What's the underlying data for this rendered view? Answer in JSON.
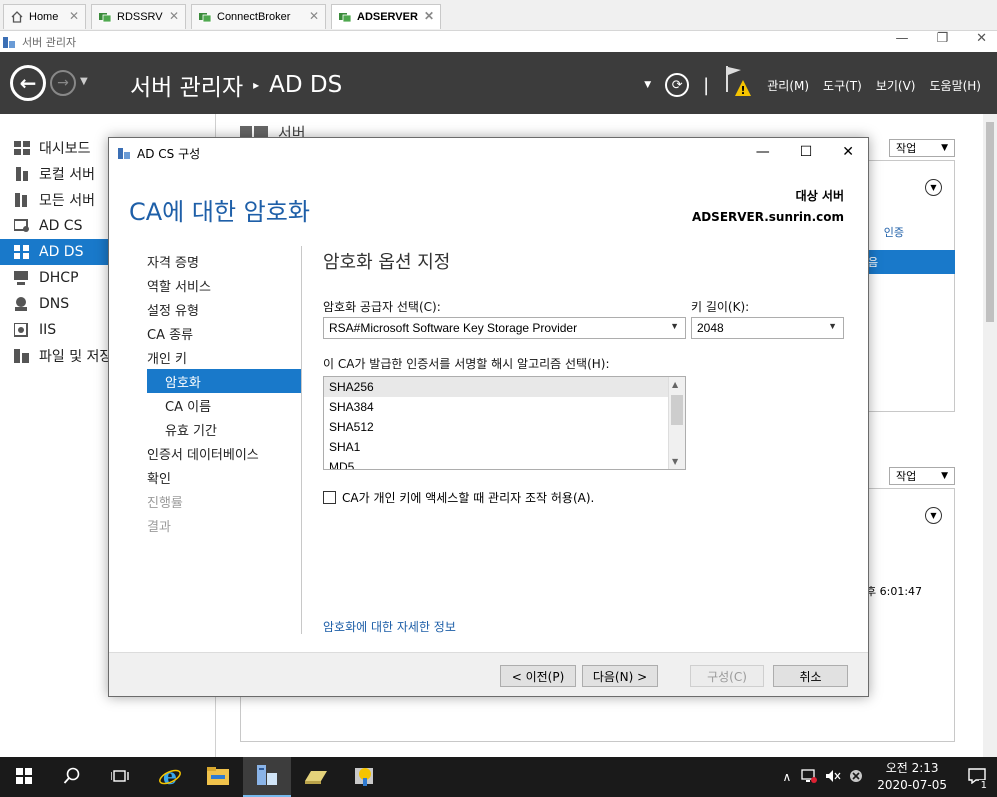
{
  "host_tabs": [
    {
      "label": "Home"
    },
    {
      "label": "RDSSRV"
    },
    {
      "label": "ConnectBroker"
    },
    {
      "label": "ADSERVER"
    }
  ],
  "window": {
    "title": "서버 관리자"
  },
  "header": {
    "breadcrumb_root": "서버 관리자",
    "breadcrumb_current": "AD DS",
    "menu_manage": "관리(M)",
    "menu_tools": "도구(T)",
    "menu_view": "보기(V)",
    "menu_help": "도움말(H)"
  },
  "sidebar": {
    "items": [
      {
        "label": "대시보드"
      },
      {
        "label": "로컬 서버"
      },
      {
        "label": "모든 서버"
      },
      {
        "label": "AD CS"
      },
      {
        "label": "AD DS"
      },
      {
        "label": "DHCP"
      },
      {
        "label": "DNS"
      },
      {
        "label": "IIS"
      },
      {
        "label": "파일 및 저장"
      }
    ]
  },
  "background": {
    "section_title": "서버",
    "tasks_label": "작업",
    "partial_col": "인증",
    "partial_row": "음",
    "partial_time": "후 6:01:47"
  },
  "dialog": {
    "title": "AD CS 구성",
    "heading": "CA에 대한 암호화",
    "target_label": "대상 서버",
    "target_value": "ADSERVER.sunrin.com",
    "steps": [
      {
        "label": "자격 증명"
      },
      {
        "label": "역할 서비스"
      },
      {
        "label": "설정 유형"
      },
      {
        "label": "CA 종류"
      },
      {
        "label": "개인 키"
      },
      {
        "label": "암호화"
      },
      {
        "label": "CA 이름"
      },
      {
        "label": "유효 기간"
      },
      {
        "label": "인증서 데이터베이스"
      },
      {
        "label": "확인"
      },
      {
        "label": "진행률"
      },
      {
        "label": "결과"
      }
    ],
    "pane_title": "암호화 옵션 지정",
    "provider_label": "암호화 공급자 선택(C):",
    "provider_value": "RSA#Microsoft Software Key Storage Provider",
    "keylen_label": "키 길이(K):",
    "keylen_value": "2048",
    "hash_label": "이 CA가 발급한 인증서를 서명할 해시 알고리즘 선택(H):",
    "hash_options": [
      {
        "label": "SHA256"
      },
      {
        "label": "SHA384"
      },
      {
        "label": "SHA512"
      },
      {
        "label": "SHA1"
      },
      {
        "label": "MD5"
      }
    ],
    "checkbox_label": "CA가 개인 키에 액세스할 때 관리자 조작 허용(A).",
    "more_link": "암호화에 대한 자세한 정보",
    "btn_prev": "< 이전(P)",
    "btn_next": "다음(N) >",
    "btn_configure": "구성(C)",
    "btn_cancel": "취소"
  },
  "taskbar": {
    "time": "오전 2:13",
    "date": "2020-07-05",
    "notifications": "1"
  }
}
